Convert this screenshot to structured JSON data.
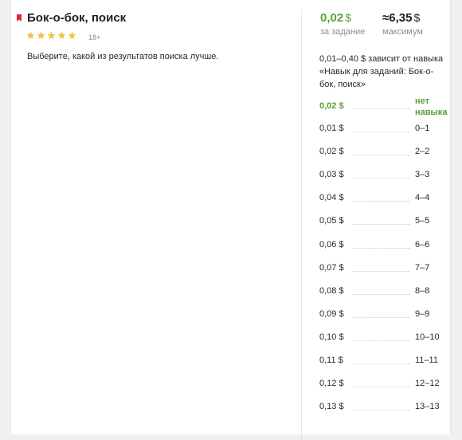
{
  "task": {
    "title": "Бок-о-бок, поиск",
    "rating_stars": 5,
    "age_label": "18+",
    "description": "Выберите, какой из результатов поиска лучше."
  },
  "pricing": {
    "per_task_value": "0,02",
    "per_task_currency": "$",
    "per_task_caption": "за задание",
    "max_value": "≈6,35",
    "max_currency": "$",
    "max_caption": "максимум",
    "skill_note": "0,01–0,40 $ зависит от навыка «Навык для заданий: Бок-о-бок, поиск»"
  },
  "rates": [
    {
      "price": "0,02 $",
      "level": "нет навыка",
      "current": true
    },
    {
      "price": "0,01 $",
      "level": "0–1"
    },
    {
      "price": "0,02 $",
      "level": "2–2"
    },
    {
      "price": "0,03 $",
      "level": "3–3"
    },
    {
      "price": "0,04 $",
      "level": "4–4"
    },
    {
      "price": "0,05 $",
      "level": "5–5"
    },
    {
      "price": "0,06 $",
      "level": "6–6"
    },
    {
      "price": "0,07 $",
      "level": "7–7"
    },
    {
      "price": "0,08 $",
      "level": "8–8"
    },
    {
      "price": "0,09 $",
      "level": "9–9"
    },
    {
      "price": "0,10 $",
      "level": "10–10"
    },
    {
      "price": "0,11 $",
      "level": "11–11"
    },
    {
      "price": "0,12 $",
      "level": "12–12"
    },
    {
      "price": "0,13 $",
      "level": "13–13"
    }
  ],
  "colors": {
    "accent_green": "#5aa231",
    "bookmark_red": "#e3242b",
    "star_yellow": "#f3c343"
  }
}
